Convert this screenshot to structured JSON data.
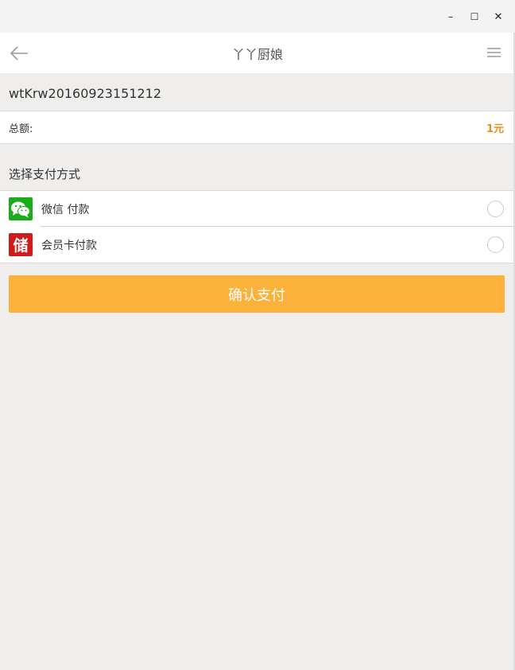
{
  "window": {
    "minimize_glyph": "–",
    "maximize_glyph": "☐",
    "close_glyph": "✕"
  },
  "nav": {
    "title": "丫丫厨娘",
    "back_icon": "arrow-left-icon",
    "menu_icon": "hamburger-menu-icon"
  },
  "order": {
    "number": "wtKrw20160923151212"
  },
  "total": {
    "label": "总额:",
    "value": "1元"
  },
  "payment": {
    "heading": "选择支付方式",
    "methods": [
      {
        "label": "微信 付款",
        "icon": "wechat-icon",
        "selected": false
      },
      {
        "label": "会员卡付款",
        "icon": "member-card-icon",
        "icon_glyph": "储",
        "selected": false
      }
    ]
  },
  "confirm": {
    "label": "确认支付"
  },
  "colors": {
    "accent": "#fcb13a",
    "price": "#f08c1e",
    "wechat": "#1aad19",
    "card": "#d11a1a"
  }
}
